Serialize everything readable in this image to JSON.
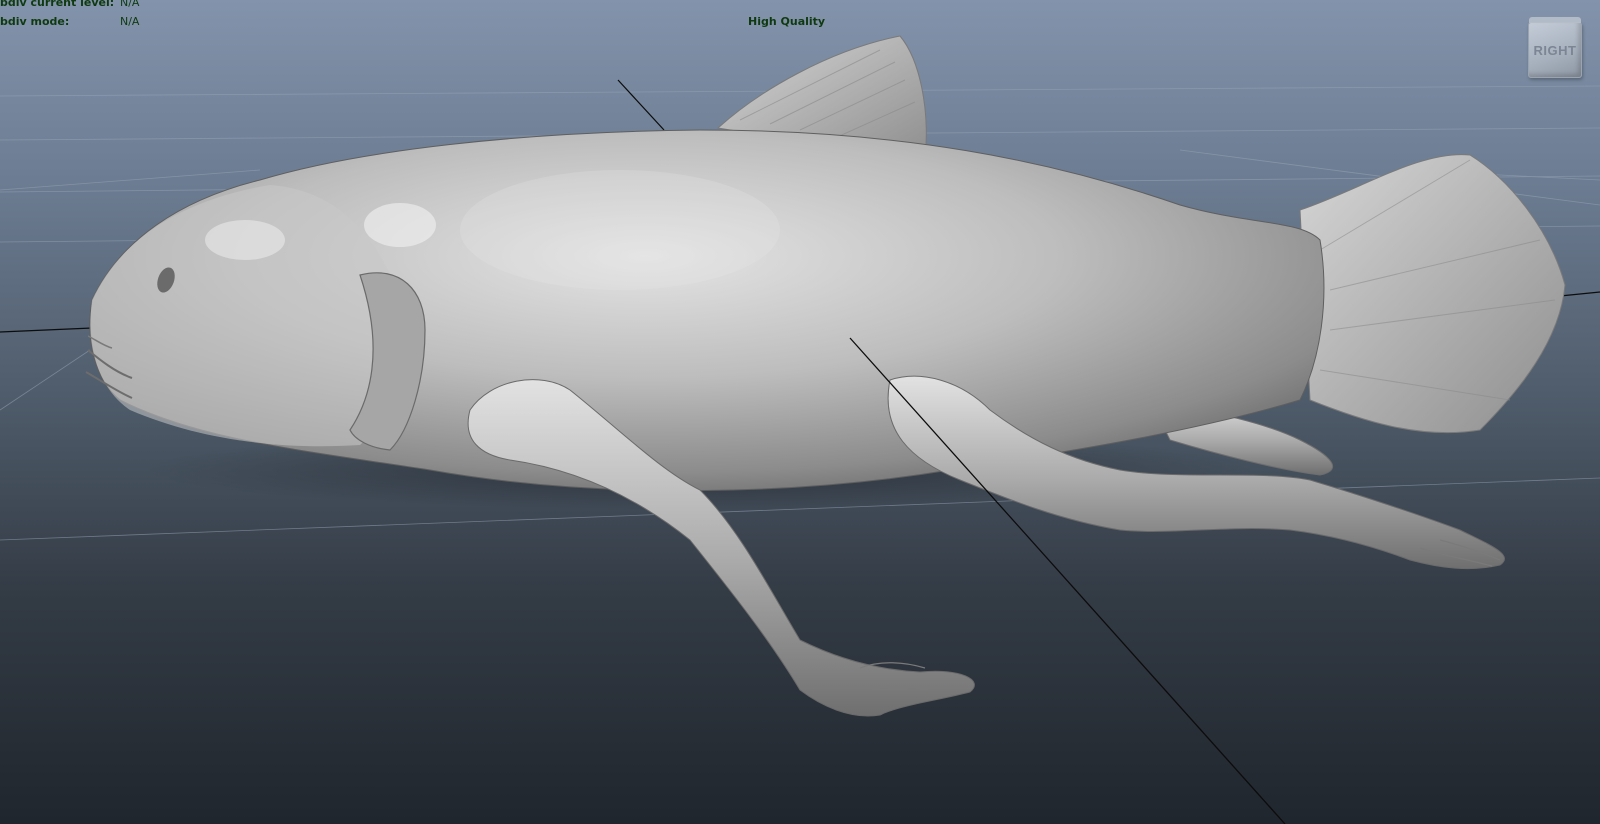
{
  "hud": {
    "subdiv_level_label": "bdiv current level:",
    "subdiv_level_value": "N/A",
    "subdiv_mode_label": "bdiv mode:",
    "subdiv_mode_value": "N/A",
    "quality_label": "High Quality"
  },
  "viewcube": {
    "face_label": "RIGHT"
  },
  "colors": {
    "hud_text": "#0f3a0f",
    "background_top": "#8293ab",
    "background_bottom": "#20262d",
    "model_surface": "#b9b9b9",
    "grid_line": "#9aa6b8"
  },
  "scene": {
    "model": "fish-creature-with-human-arms",
    "grid": true
  }
}
